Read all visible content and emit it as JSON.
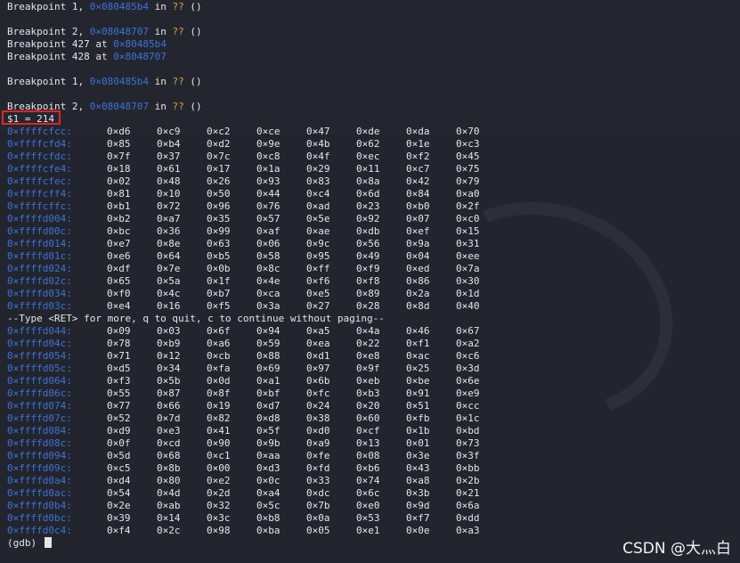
{
  "breakpoints": [
    {
      "prefix": "Breakpoint 1, ",
      "addr": "0×080485b4",
      "mid": " in ",
      "q": "??",
      "tail": " ()"
    },
    {
      "prefix": "Breakpoint 2, ",
      "addr": "0×08048707",
      "mid": " in ",
      "q": "??",
      "tail": " ()"
    },
    {
      "prefix": "Breakpoint 427 at ",
      "addr": "0×80485b4",
      "mid": "",
      "q": "",
      "tail": ""
    },
    {
      "prefix": "Breakpoint 428 at ",
      "addr": "0×8048707",
      "mid": "",
      "q": "",
      "tail": ""
    },
    {
      "prefix": "Breakpoint 1, ",
      "addr": "0×080485b4",
      "mid": " in ",
      "q": "??",
      "tail": " ()"
    },
    {
      "prefix": "Breakpoint 2, ",
      "addr": "0×08048707",
      "mid": " in ",
      "q": "??",
      "tail": " ()"
    }
  ],
  "result": "$1 = 214",
  "rows_a": [
    {
      "addr": "0×ffffcfcc:",
      "v": [
        "0×d6",
        "0×c9",
        "0×c2",
        "0×ce",
        "0×47",
        "0×de",
        "0×da",
        "0×70"
      ]
    },
    {
      "addr": "0×ffffcfd4:",
      "v": [
        "0×85",
        "0×b4",
        "0×d2",
        "0×9e",
        "0×4b",
        "0×62",
        "0×1e",
        "0×c3"
      ]
    },
    {
      "addr": "0×ffffcfdc:",
      "v": [
        "0×7f",
        "0×37",
        "0×7c",
        "0×c8",
        "0×4f",
        "0×ec",
        "0×f2",
        "0×45"
      ]
    },
    {
      "addr": "0×ffffcfe4:",
      "v": [
        "0×18",
        "0×61",
        "0×17",
        "0×1a",
        "0×29",
        "0×11",
        "0×c7",
        "0×75"
      ]
    },
    {
      "addr": "0×ffffcfec:",
      "v": [
        "0×02",
        "0×48",
        "0×26",
        "0×93",
        "0×83",
        "0×8a",
        "0×42",
        "0×79"
      ]
    },
    {
      "addr": "0×ffffcff4:",
      "v": [
        "0×81",
        "0×10",
        "0×50",
        "0×44",
        "0×c4",
        "0×6d",
        "0×84",
        "0×a0"
      ]
    },
    {
      "addr": "0×ffffcffc:",
      "v": [
        "0×b1",
        "0×72",
        "0×96",
        "0×76",
        "0×ad",
        "0×23",
        "0×b0",
        "0×2f"
      ]
    },
    {
      "addr": "0×ffffd004:",
      "v": [
        "0×b2",
        "0×a7",
        "0×35",
        "0×57",
        "0×5e",
        "0×92",
        "0×07",
        "0×c0"
      ]
    },
    {
      "addr": "0×ffffd00c:",
      "v": [
        "0×bc",
        "0×36",
        "0×99",
        "0×af",
        "0×ae",
        "0×db",
        "0×ef",
        "0×15"
      ]
    },
    {
      "addr": "0×ffffd014:",
      "v": [
        "0×e7",
        "0×8e",
        "0×63",
        "0×06",
        "0×9c",
        "0×56",
        "0×9a",
        "0×31"
      ]
    },
    {
      "addr": "0×ffffd01c:",
      "v": [
        "0×e6",
        "0×64",
        "0×b5",
        "0×58",
        "0×95",
        "0×49",
        "0×04",
        "0×ee"
      ]
    },
    {
      "addr": "0×ffffd024:",
      "v": [
        "0×df",
        "0×7e",
        "0×0b",
        "0×8c",
        "0×ff",
        "0×f9",
        "0×ed",
        "0×7a"
      ]
    },
    {
      "addr": "0×ffffd02c:",
      "v": [
        "0×65",
        "0×5a",
        "0×1f",
        "0×4e",
        "0×f6",
        "0×f8",
        "0×86",
        "0×30"
      ]
    },
    {
      "addr": "0×ffffd034:",
      "v": [
        "0×f0",
        "0×4c",
        "0×b7",
        "0×ca",
        "0×e5",
        "0×89",
        "0×2a",
        "0×1d"
      ]
    },
    {
      "addr": "0×ffffd03c:",
      "v": [
        "0×e4",
        "0×16",
        "0×f5",
        "0×3a",
        "0×27",
        "0×28",
        "0×8d",
        "0×40"
      ]
    }
  ],
  "paging": "--Type <RET> for more, q to quit, c to continue without paging--",
  "rows_b": [
    {
      "addr": "0×ffffd044:",
      "v": [
        "0×09",
        "0×03",
        "0×6f",
        "0×94",
        "0×a5",
        "0×4a",
        "0×46",
        "0×67"
      ]
    },
    {
      "addr": "0×ffffd04c:",
      "v": [
        "0×78",
        "0×b9",
        "0×a6",
        "0×59",
        "0×ea",
        "0×22",
        "0×f1",
        "0×a2"
      ]
    },
    {
      "addr": "0×ffffd054:",
      "v": [
        "0×71",
        "0×12",
        "0×cb",
        "0×88",
        "0×d1",
        "0×e8",
        "0×ac",
        "0×c6"
      ]
    },
    {
      "addr": "0×ffffd05c:",
      "v": [
        "0×d5",
        "0×34",
        "0×fa",
        "0×69",
        "0×97",
        "0×9f",
        "0×25",
        "0×3d"
      ]
    },
    {
      "addr": "0×ffffd064:",
      "v": [
        "0×f3",
        "0×5b",
        "0×0d",
        "0×a1",
        "0×6b",
        "0×eb",
        "0×be",
        "0×6e"
      ]
    },
    {
      "addr": "0×ffffd06c:",
      "v": [
        "0×55",
        "0×87",
        "0×8f",
        "0×bf",
        "0×fc",
        "0×b3",
        "0×91",
        "0×e9"
      ]
    },
    {
      "addr": "0×ffffd074:",
      "v": [
        "0×77",
        "0×66",
        "0×19",
        "0×d7",
        "0×24",
        "0×20",
        "0×51",
        "0×cc"
      ]
    },
    {
      "addr": "0×ffffd07c:",
      "v": [
        "0×52",
        "0×7d",
        "0×82",
        "0×d8",
        "0×38",
        "0×60",
        "0×fb",
        "0×1c"
      ]
    },
    {
      "addr": "0×ffffd084:",
      "v": [
        "0×d9",
        "0×e3",
        "0×41",
        "0×5f",
        "0×d0",
        "0×cf",
        "0×1b",
        "0×bd"
      ]
    },
    {
      "addr": "0×ffffd08c:",
      "v": [
        "0×0f",
        "0×cd",
        "0×90",
        "0×9b",
        "0×a9",
        "0×13",
        "0×01",
        "0×73"
      ]
    },
    {
      "addr": "0×ffffd094:",
      "v": [
        "0×5d",
        "0×68",
        "0×c1",
        "0×aa",
        "0×fe",
        "0×08",
        "0×3e",
        "0×3f"
      ]
    },
    {
      "addr": "0×ffffd09c:",
      "v": [
        "0×c5",
        "0×8b",
        "0×00",
        "0×d3",
        "0×fd",
        "0×b6",
        "0×43",
        "0×bb"
      ]
    },
    {
      "addr": "0×ffffd0a4:",
      "v": [
        "0×d4",
        "0×80",
        "0×e2",
        "0×0c",
        "0×33",
        "0×74",
        "0×a8",
        "0×2b"
      ]
    },
    {
      "addr": "0×ffffd0ac:",
      "v": [
        "0×54",
        "0×4d",
        "0×2d",
        "0×a4",
        "0×dc",
        "0×6c",
        "0×3b",
        "0×21"
      ]
    },
    {
      "addr": "0×ffffd0b4:",
      "v": [
        "0×2e",
        "0×ab",
        "0×32",
        "0×5c",
        "0×7b",
        "0×e0",
        "0×9d",
        "0×6a"
      ]
    },
    {
      "addr": "0×ffffd0bc:",
      "v": [
        "0×39",
        "0×14",
        "0×3c",
        "0×b8",
        "0×0a",
        "0×53",
        "0×f7",
        "0×dd"
      ]
    },
    {
      "addr": "0×ffffd0c4:",
      "v": [
        "0×f4",
        "0×2c",
        "0×98",
        "0×ba",
        "0×05",
        "0×e1",
        "0×0e",
        "0×a3"
      ]
    }
  ],
  "prompt": "(gdb) ",
  "watermark": "CSDN @大灬白"
}
